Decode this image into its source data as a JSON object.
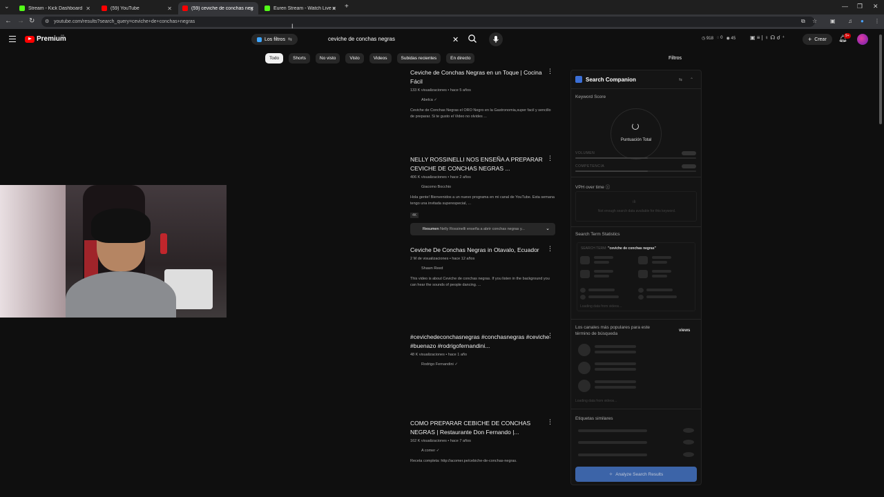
{
  "browser": {
    "tabs": [
      {
        "label": "Stream - Kick Dashboard",
        "icon": "kick"
      },
      {
        "label": "(59) YouTube",
        "icon": "yt"
      },
      {
        "label": "(59) ceviche de conchas negras",
        "icon": "yt"
      },
      {
        "label": "Euren Stream - Watch Live on K",
        "icon": "kick"
      }
    ],
    "new_tab": "+",
    "url": "youtube.com/results?search_query=ceviche+de+conchas+negras"
  },
  "header": {
    "logo": "Premium",
    "country": "PE",
    "filters_button": "Los filtros",
    "search_value": "ceviche de conchas negras",
    "stats": [
      "918",
      "0",
      "45"
    ],
    "create_label": "Crear",
    "notifications_badge": "9+"
  },
  "chips": [
    "Todo",
    "Shorts",
    "No visto",
    "Visto",
    "Videos",
    "Subidas recientes",
    "En directo"
  ],
  "filtros_label": "Filtros",
  "results": [
    {
      "title": "Ceviche de Conchas Negras en un Toque | Cocina Fácil",
      "meta": "133 K visualizaciones • hace 5 años",
      "channel": "Abelca",
      "desc": "Ceviche de Conchas Negras el ORO Negro en la Gastronomia,super facil y sencillo de preparar. Si te gusto el Video no olvides ..."
    },
    {
      "title": "NELLY ROSSINELLI NOS ENSEÑA A PREPARAR CEVICHE DE CONCHAS NEGRAS ...",
      "meta": "406 K visualizaciones • hace 2 años",
      "channel": "Giacomo Bocchio",
      "desc": "Hola gente! Bienvenidos a un nuevo programa en mi canal de YouTube. Esta semana tengo una invitada superespecial, ...",
      "badge": "4K"
    },
    {
      "title": "Ceviche De Conchas Negras in Otavalo, Ecuador",
      "meta": "2 M de visualizaciones • hace 12 años",
      "channel": "Shawn Reed",
      "desc": "This video is about Ceviche de conchas negras. If you listen in the background you can hear the sounds of people dancing. ..."
    },
    {
      "title": "#cevichedeconchasnegras #conchasnegras #ceviche #buenazo #rodrigofernandini...",
      "meta": "48 K visualizaciones • hace 1 año",
      "channel": "Rodrigo Fernandini"
    },
    {
      "title": "COMO PREPARAR CEBICHE DE CONCHAS NEGRAS | Restaurante Don Fernando |...",
      "meta": "162 K visualizaciones • hace 7 años",
      "channel": "A comer",
      "desc": "Receta completa: http://acomer.pe/cebiche-de-conchas-negras."
    }
  ],
  "summary": {
    "label": "Resumen",
    "text": "Nelly Rossinelli enseña a abrir conchas negras y..."
  },
  "companion": {
    "title": "Search Companion",
    "keyword_score": "Keyword Score",
    "score_label": "Puntuación Total",
    "volume_label": "VOLUMEN",
    "competition_label": "COMPETENCIA",
    "volume_level": 0.6,
    "competition_level": 0.6,
    "vph_title": "VPH over time",
    "vph_empty": "Not enough search data available for this keyword.",
    "stats_title": "Search Term Statistics",
    "search_term_label": "SEARCH TERM:",
    "search_term": "\"ceviche de conchas negras\"",
    "loading_text": "Loading data from videos...",
    "channels_title": "Los canales más populares para este término de búsqueda",
    "views_label": "views",
    "tags_title": "Etiquetas similares",
    "analyze_button": "Analyze Search Results"
  }
}
